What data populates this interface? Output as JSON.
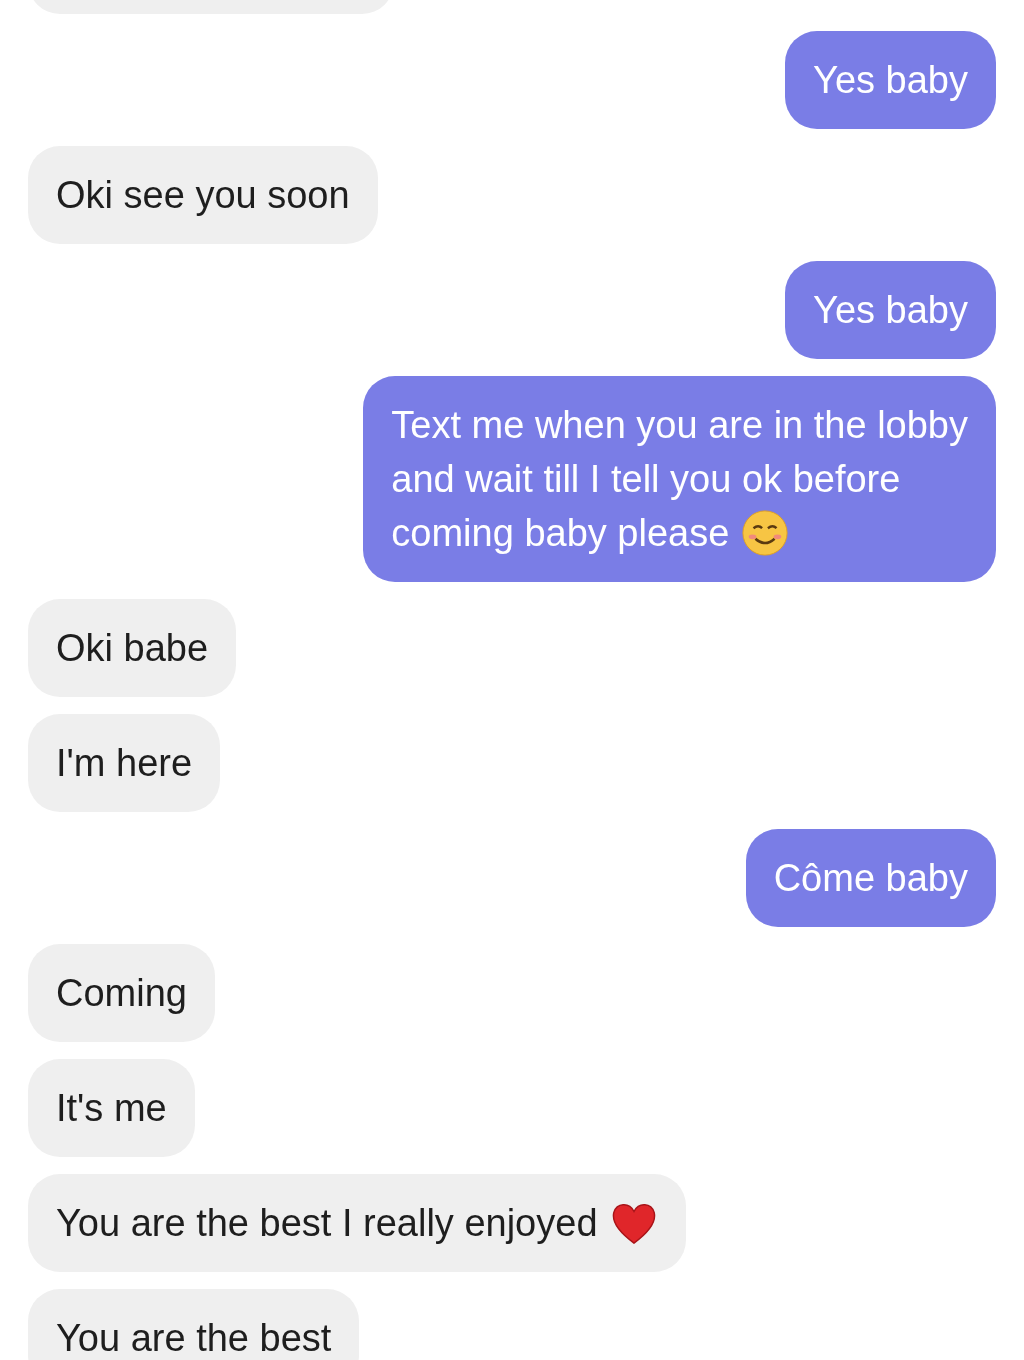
{
  "messages": [
    {
      "kind": "received"
    },
    {
      "kind": "sent",
      "lines": [
        "Yes baby"
      ]
    },
    {
      "kind": "received",
      "lines": [
        "Oki see you soon"
      ]
    },
    {
      "kind": "sent",
      "lines": [
        "Yes baby"
      ]
    },
    {
      "kind": "sent",
      "lines": [
        "Text me when you are in the lobby",
        "and wait till I tell you ok before",
        "coming baby please"
      ],
      "emoji": true
    },
    {
      "kind": "received",
      "lines": [
        "Oki babe"
      ]
    },
    {
      "kind": "received",
      "lines": [
        "I'm here"
      ]
    },
    {
      "kind": "sent",
      "lines": [
        "Côme baby"
      ]
    },
    {
      "kind": "received",
      "lines": [
        "Coming"
      ]
    },
    {
      "kind": "received",
      "lines": [
        "It's me"
      ]
    },
    {
      "kind": "received",
      "lines": [
        "You are the best I really enjoyed"
      ],
      "emoji": true
    },
    {
      "kind": "received",
      "lines": [
        "You are the best"
      ]
    }
  ]
}
